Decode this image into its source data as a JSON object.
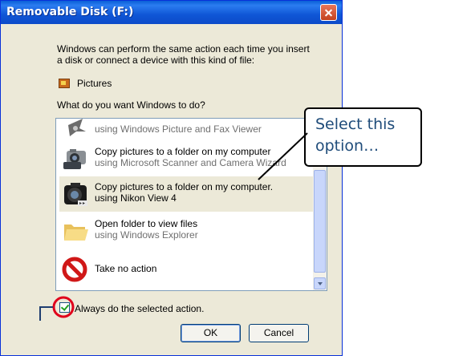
{
  "window": {
    "title": "Removable Disk (F:)",
    "intro_line1": "Windows can perform the same action each time you insert",
    "intro_line2": "a disk or connect a device with this kind of file:",
    "content_type": "Pictures",
    "question": "What do you want Windows to do?"
  },
  "actions": [
    {
      "title": "",
      "subtitle": "using Windows Picture and Fax Viewer",
      "icon": "fax-viewer-icon"
    },
    {
      "title": "Copy pictures to a folder on my computer",
      "subtitle": "using Microsoft Scanner and Camera Wizard",
      "icon": "camera-wizard-icon"
    },
    {
      "title": "Copy pictures to a folder on my computer.",
      "subtitle": "using Nikon View 4",
      "icon": "nikon-camera-icon",
      "selected": true
    },
    {
      "title": "Open folder to view files",
      "subtitle": "using Windows Explorer",
      "icon": "folder-icon"
    },
    {
      "title": "Take no action",
      "subtitle": "",
      "icon": "no-action-icon"
    }
  ],
  "checkbox": {
    "label": "Always do the selected action.",
    "checked": true
  },
  "buttons": {
    "ok": "OK",
    "cancel": "Cancel"
  },
  "callout": {
    "line1": "Select this",
    "line2": "option…"
  },
  "colors": {
    "titlebar": "#0c4bc9",
    "dialog_bg": "#ece9d8",
    "callout_text": "#1f4c7a",
    "highlight_circle": "#e0001b"
  }
}
